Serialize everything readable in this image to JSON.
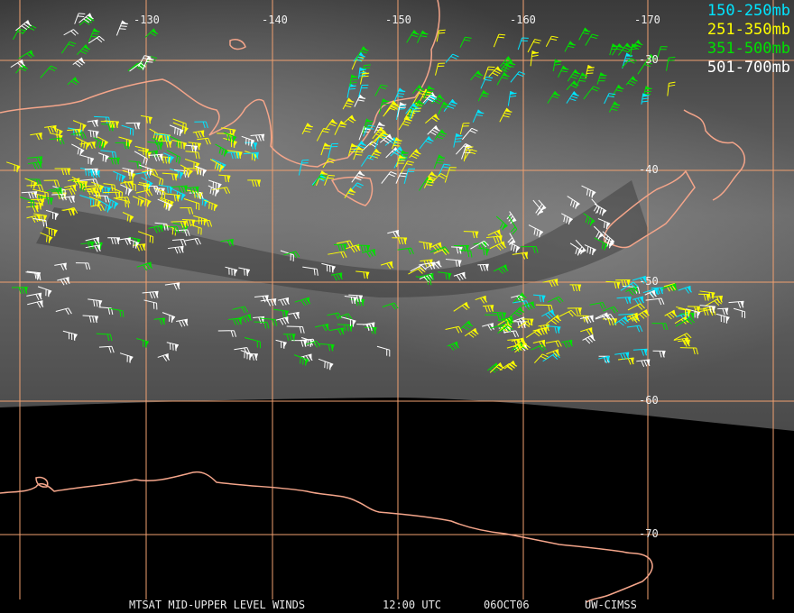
{
  "legend": [
    {
      "label": "150-250mb",
      "color": "#00e5ff"
    },
    {
      "label": "251-350mb",
      "color": "#ffff00"
    },
    {
      "label": "351-500mb",
      "color": "#00e000"
    },
    {
      "label": "501-700mb",
      "color": "#ffffff"
    }
  ],
  "longitude_labels": [
    "-130",
    "-140",
    "-150",
    "-160",
    "-170"
  ],
  "latitude_labels": [
    "-30",
    "-40",
    "-50",
    "-60",
    "-70"
  ],
  "footer": {
    "product": "MTSAT MID-UPPER LEVEL WINDS",
    "time": "12:00 UTC",
    "date": "06OCT06",
    "credit": "UW-CIMSS"
  },
  "colors": {
    "grid": "#f0a070",
    "coast": "#f4a58a",
    "background": "#000000"
  }
}
